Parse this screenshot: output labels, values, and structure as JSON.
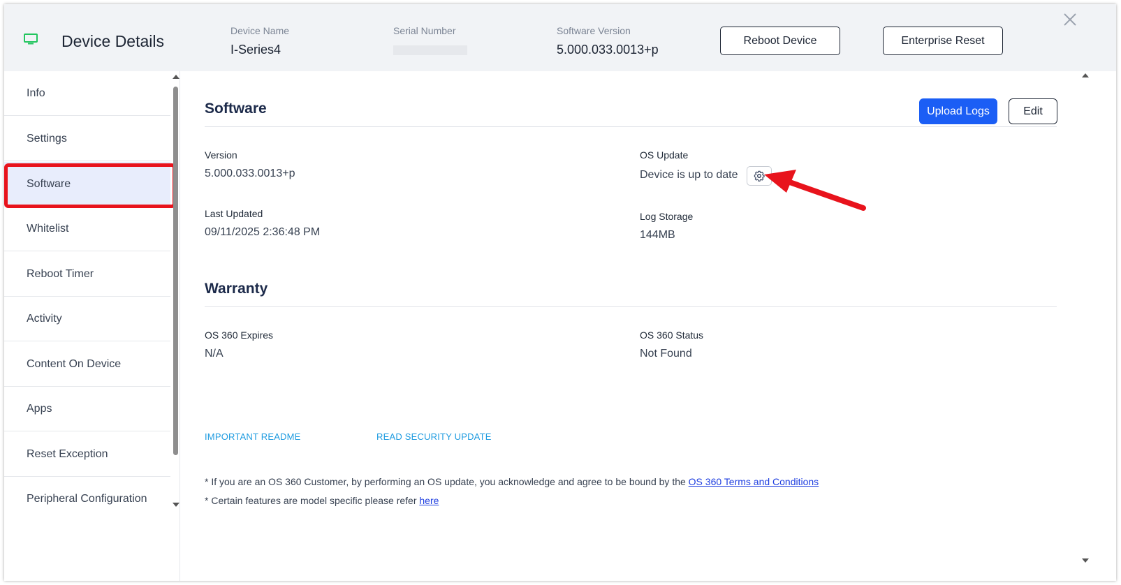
{
  "header": {
    "title": "Device Details",
    "device_name_label": "Device Name",
    "device_name_value": "I-Series4",
    "serial_label": "Serial Number",
    "software_version_label": "Software Version",
    "software_version_value": "5.000.033.0013+p",
    "reboot_label": "Reboot Device",
    "enterprise_reset_label": "Enterprise Reset"
  },
  "sidebar": {
    "items": [
      {
        "label": "Info"
      },
      {
        "label": "Settings"
      },
      {
        "label": "Software"
      },
      {
        "label": "Whitelist"
      },
      {
        "label": "Reboot Timer"
      },
      {
        "label": "Activity"
      },
      {
        "label": "Content On Device"
      },
      {
        "label": "Apps"
      },
      {
        "label": "Reset Exception"
      },
      {
        "label": "Peripheral Configuration"
      }
    ],
    "active": "Software"
  },
  "software": {
    "title": "Software",
    "upload_logs_label": "Upload Logs",
    "edit_label": "Edit",
    "version_label": "Version",
    "version_value": "5.000.033.0013+p",
    "os_update_label": "OS Update",
    "os_update_value": "Device is up to date",
    "last_updated_label": "Last Updated",
    "last_updated_value": "09/11/2025 2:36:48 PM",
    "log_storage_label": "Log Storage",
    "log_storage_value": "144MB"
  },
  "warranty": {
    "title": "Warranty",
    "expires_label": "OS 360 Expires",
    "expires_value": "N/A",
    "status_label": "OS 360 Status",
    "status_value": "Not Found"
  },
  "links": {
    "readme": "IMPORTANT README",
    "security": "READ SECURITY UPDATE"
  },
  "notes": {
    "terms_prefix": "* If you are an OS 360 Customer, by performing an OS update, you acknowledge and agree to be bound by the ",
    "terms_link": "OS 360 Terms and Conditions",
    "model_prefix": "* Certain features are model specific please refer ",
    "model_link": "here"
  },
  "colors": {
    "accent": "#1b5ef5",
    "highlight": "#e8131c",
    "link": "#1e9be0",
    "active_bg": "#e8edfc"
  }
}
